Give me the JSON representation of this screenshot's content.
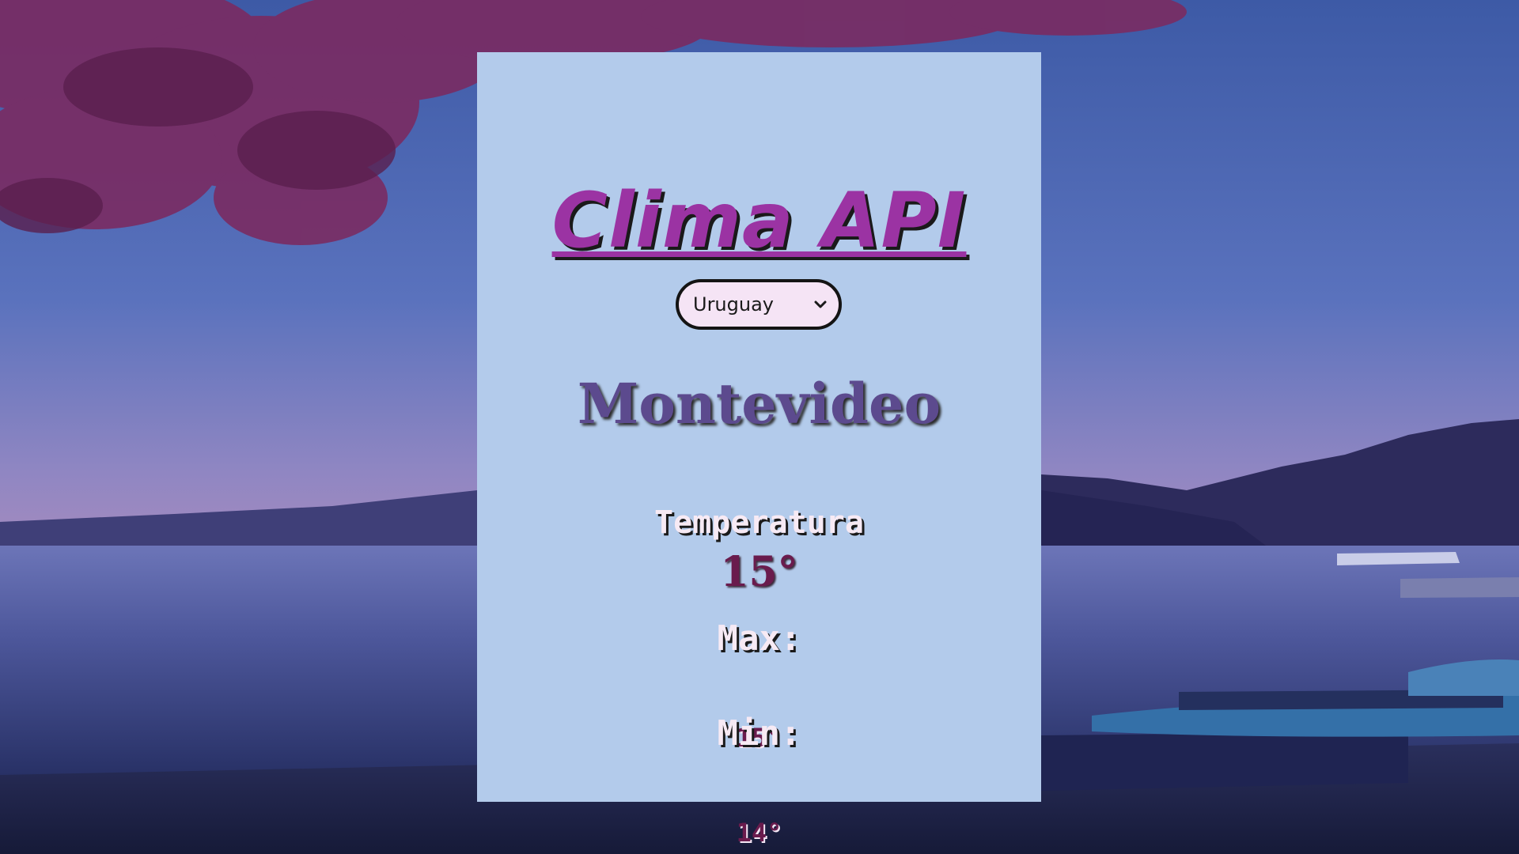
{
  "app": {
    "title": "Clima API"
  },
  "country_select": {
    "selected": "Uruguay"
  },
  "weather": {
    "city": "Montevideo",
    "temperature_label": "Temperatura",
    "temperature_value": "15°",
    "max_label": "Max:",
    "max_value": "15°",
    "min_label": "Min:",
    "min_value": "14°"
  },
  "colors": {
    "card_background": "#b3cbeb",
    "title_color": "#9b33a3",
    "city_color": "#5c4a8e",
    "value_color": "#6a1b4d",
    "select_background": "#f5e4f5"
  }
}
